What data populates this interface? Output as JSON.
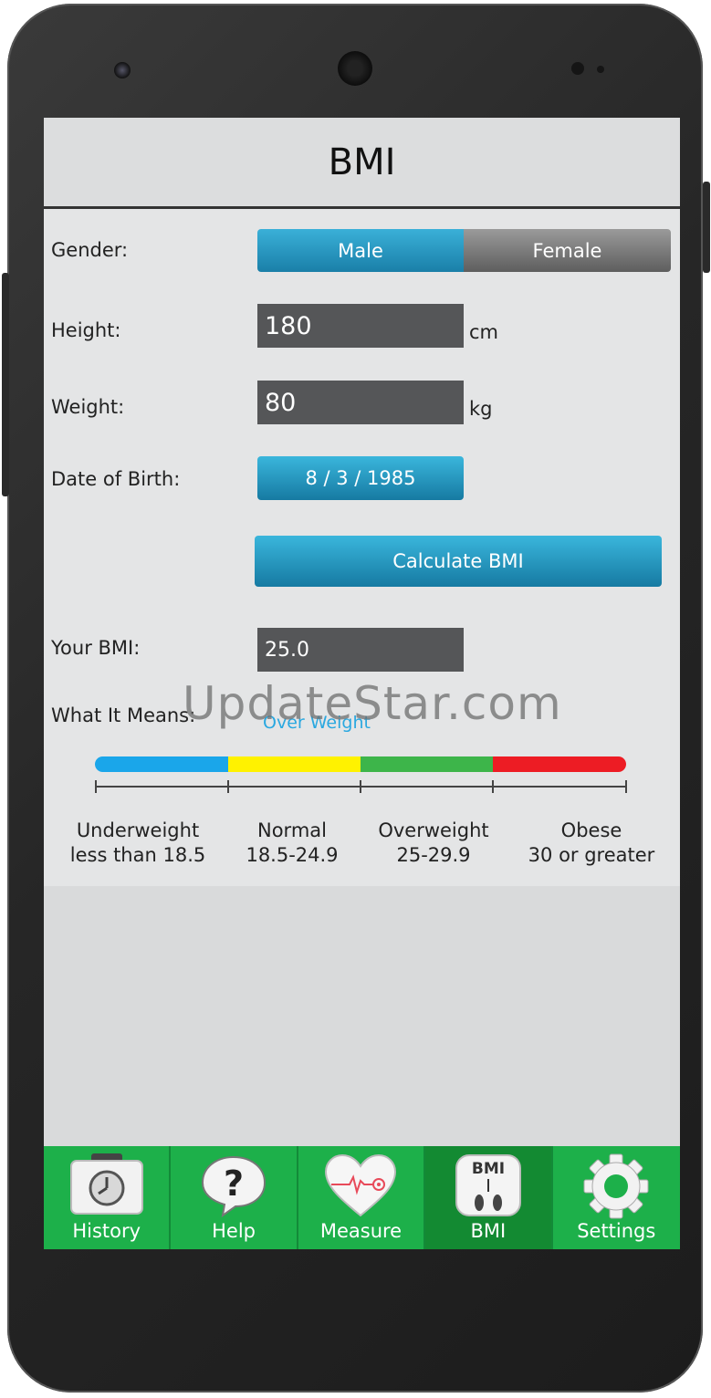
{
  "header": {
    "title": "BMI"
  },
  "form": {
    "gender_label": "Gender:",
    "gender_options": [
      "Male",
      "Female"
    ],
    "gender_selected": "Male",
    "height_label": "Height:",
    "height_value": "180",
    "height_unit": "cm",
    "weight_label": "Weight:",
    "weight_value": "80",
    "weight_unit": "kg",
    "dob_label": "Date of Birth:",
    "dob_value": "8 / 3 / 1985",
    "calculate_label": "Calculate BMI",
    "bmi_label": "Your BMI:",
    "bmi_value": "25.0",
    "meaning_label": "What It Means:",
    "meaning_value": "Over Weight"
  },
  "scale": [
    {
      "name": "Underweight",
      "range": "less than 18.5",
      "color": "#1aa6ea"
    },
    {
      "name": "Normal",
      "range": "18.5-24.9",
      "color": "#fff200"
    },
    {
      "name": "Overweight",
      "range": "25-29.9",
      "color": "#3db54a"
    },
    {
      "name": "Obese",
      "range": "30 or greater",
      "color": "#ed1c24"
    }
  ],
  "watermark": "UpdateStar.com",
  "nav": {
    "items": [
      {
        "label": "History",
        "icon": "clock-icon"
      },
      {
        "label": "Help",
        "icon": "question-bubble-icon"
      },
      {
        "label": "Measure",
        "icon": "heart-pulse-icon"
      },
      {
        "label": "BMI",
        "icon": "scale-feet-icon",
        "icon_text": "BMI",
        "active": true
      },
      {
        "label": "Settings",
        "icon": "gear-icon"
      }
    ]
  },
  "colors": {
    "accent_blue": "#1a7fa8",
    "nav_green": "#1db04a",
    "nav_active": "#138a32"
  }
}
